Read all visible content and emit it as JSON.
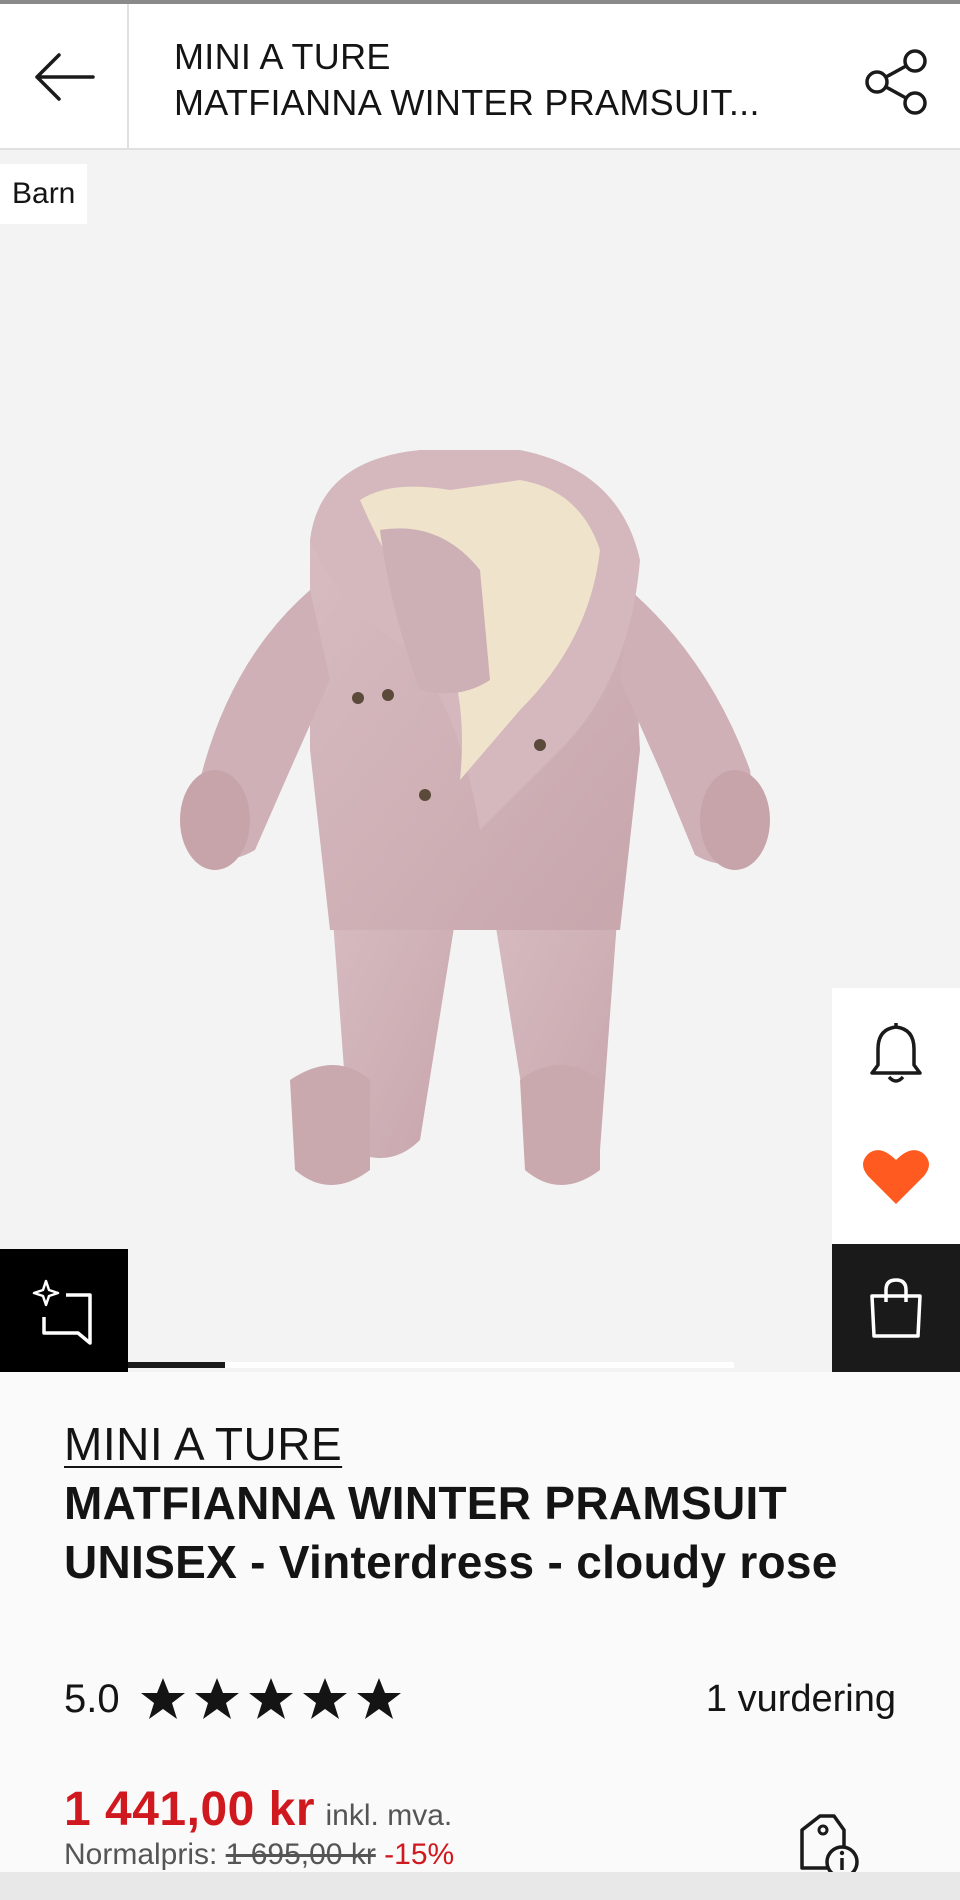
{
  "header": {
    "brand": "MINI A TURE",
    "title": "MATFIANNA WINTER PRAMSUIT..."
  },
  "gallery": {
    "badge": "Barn",
    "image_description_name": "pramsuit-image",
    "progress": 0.16
  },
  "product": {
    "brand": "MINI A TURE",
    "name": "MATFIANNA WINTER PRAMSUIT UNISEX - Vinterdress - cloudy rose",
    "rating": "5.0",
    "stars": 5,
    "reviews": "1 vurdering",
    "price": "1 441,00 kr",
    "vat_note": "inkl. mva.",
    "normal_label": "Normalpris:",
    "normal_price": "1 695,00 kr",
    "discount": "-15%"
  },
  "colors": {
    "sale_red": "#d0191f",
    "wishlist_orange": "#ff5a1f",
    "product_pink": "#d1b3b8",
    "fleece": "#efe3cc"
  },
  "icons": [
    "arrow-left-icon",
    "share-icon",
    "bell-icon",
    "heart-icon",
    "shopping-bag-icon",
    "ai-sparkle-icon",
    "price-tag-info-icon"
  ]
}
